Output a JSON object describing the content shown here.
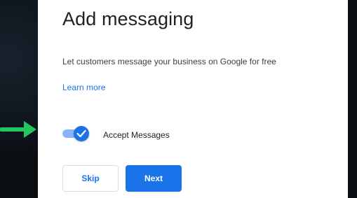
{
  "dialog": {
    "title": "Add messaging",
    "description": "Let customers message your business on Google for free",
    "learn_more_label": "Learn more",
    "toggle": {
      "label": "Accept Messages",
      "checked": true,
      "icon": "check-icon"
    },
    "buttons": {
      "skip_label": "Skip",
      "next_label": "Next"
    }
  },
  "annotation": {
    "icon": "arrow-right-icon",
    "color": "#22c55e"
  },
  "colors": {
    "accent": "#1a73e8",
    "toggle_track": "#8ab4f8",
    "background": "#0b0f14"
  }
}
